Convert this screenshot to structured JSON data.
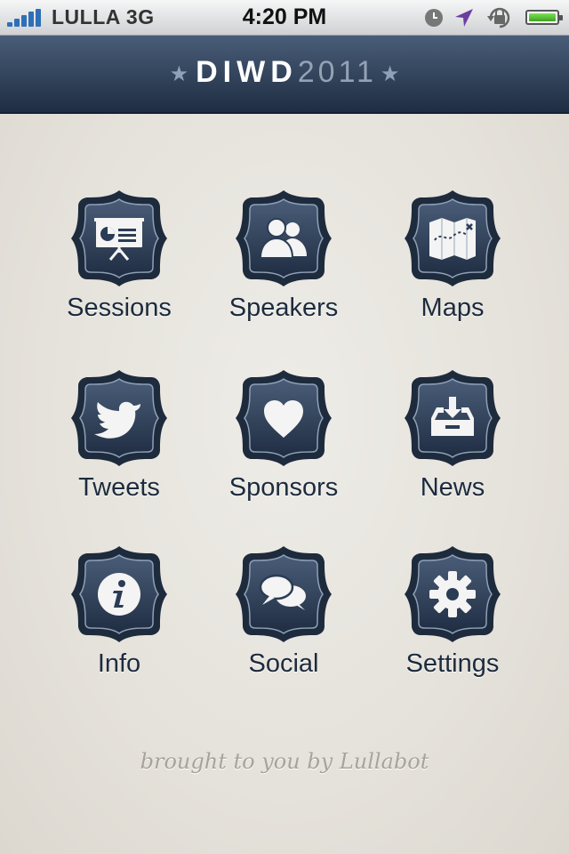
{
  "status_bar": {
    "carrier": "LULLA 3G",
    "time": "4:20 PM",
    "icons": [
      "signal-icon",
      "clock-icon",
      "location-icon",
      "rotation-lock-icon",
      "battery-icon"
    ]
  },
  "header": {
    "title_main": "DIWD",
    "title_year": "2011"
  },
  "grid": [
    {
      "label": "Sessions",
      "icon": "presentation-icon"
    },
    {
      "label": "Speakers",
      "icon": "people-icon"
    },
    {
      "label": "Maps",
      "icon": "map-icon"
    },
    {
      "label": "Tweets",
      "icon": "bird-icon"
    },
    {
      "label": "Sponsors",
      "icon": "heart-icon"
    },
    {
      "label": "News",
      "icon": "inbox-download-icon"
    },
    {
      "label": "Info",
      "icon": "info-icon"
    },
    {
      "label": "Social",
      "icon": "speech-bubbles-icon"
    },
    {
      "label": "Settings",
      "icon": "gear-icon"
    }
  ],
  "footer": {
    "credit": "brought to you by Lullabot"
  },
  "colors": {
    "header": "#1e2d42",
    "badge": "#2b3c55",
    "label": "#1d2b3d",
    "background": "#e7e4de"
  }
}
